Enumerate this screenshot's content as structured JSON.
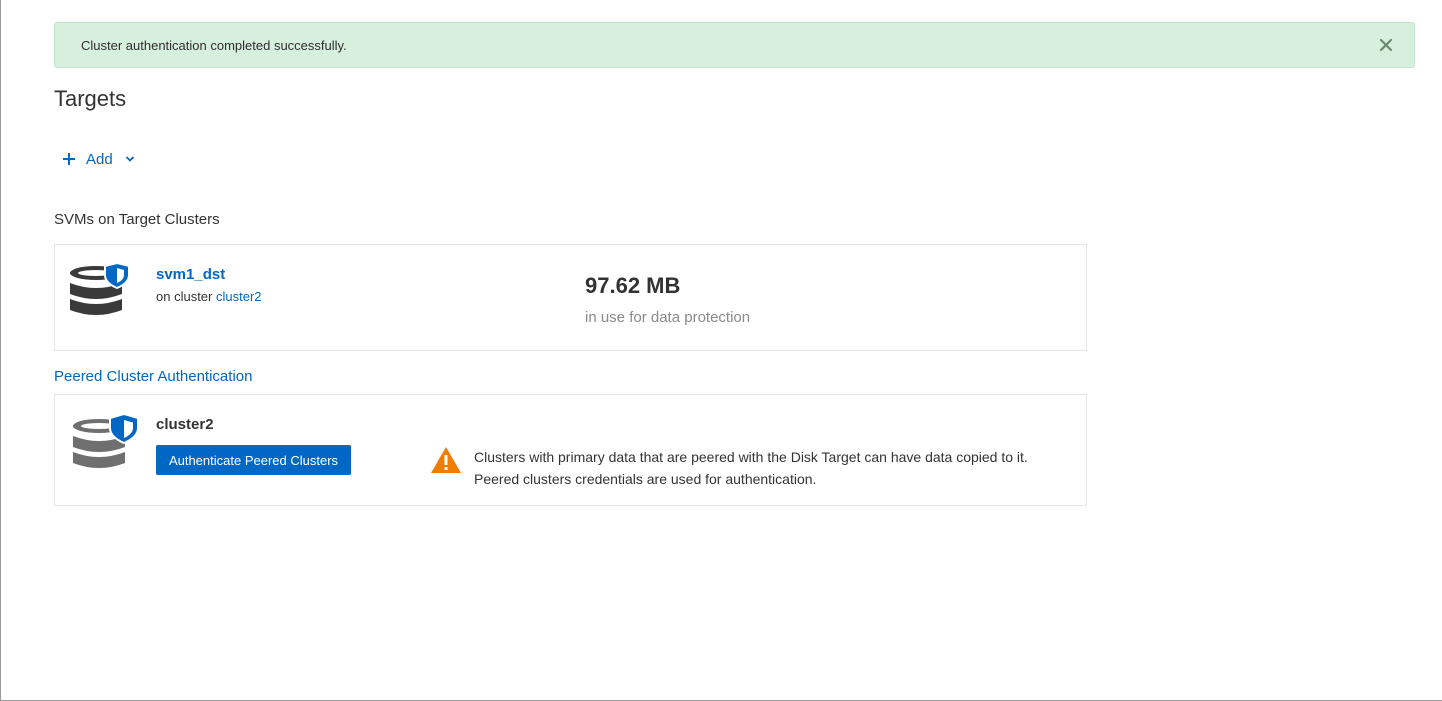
{
  "alert": {
    "message": "Cluster authentication completed successfully.",
    "close_icon": "close-icon",
    "colors": {
      "background": "#d7efdd",
      "close": "#6a8a72"
    }
  },
  "page": {
    "title": "Targets"
  },
  "toolbar": {
    "add_label": "Add",
    "add_icon": "plus-icon",
    "chevron_icon": "chevron-down-icon"
  },
  "svms_section": {
    "title": "SVMs on Target Clusters",
    "items": [
      {
        "name": "svm1_dst",
        "cluster_prefix": "on cluster",
        "cluster_name": "cluster2",
        "usage_value": "97.62 MB",
        "usage_label": "in use for data protection",
        "icon": "database-shield-icon"
      }
    ]
  },
  "peered_section": {
    "title": "Peered Cluster Authentication",
    "items": [
      {
        "name": "cluster2",
        "button_label": "Authenticate Peered Clusters",
        "icon": "database-shield-icon",
        "warning_icon": "warning-icon",
        "warning_line1": "Clusters with primary data that are peered with the Disk Target can have data copied to it.",
        "warning_line2": "Peered clusters credentials are used for authentication."
      }
    ]
  },
  "colors": {
    "accent": "#0067c5",
    "warning": "#f07c00",
    "icon_dark": "#3a3a3a",
    "icon_gray": "#6f6f6f"
  }
}
